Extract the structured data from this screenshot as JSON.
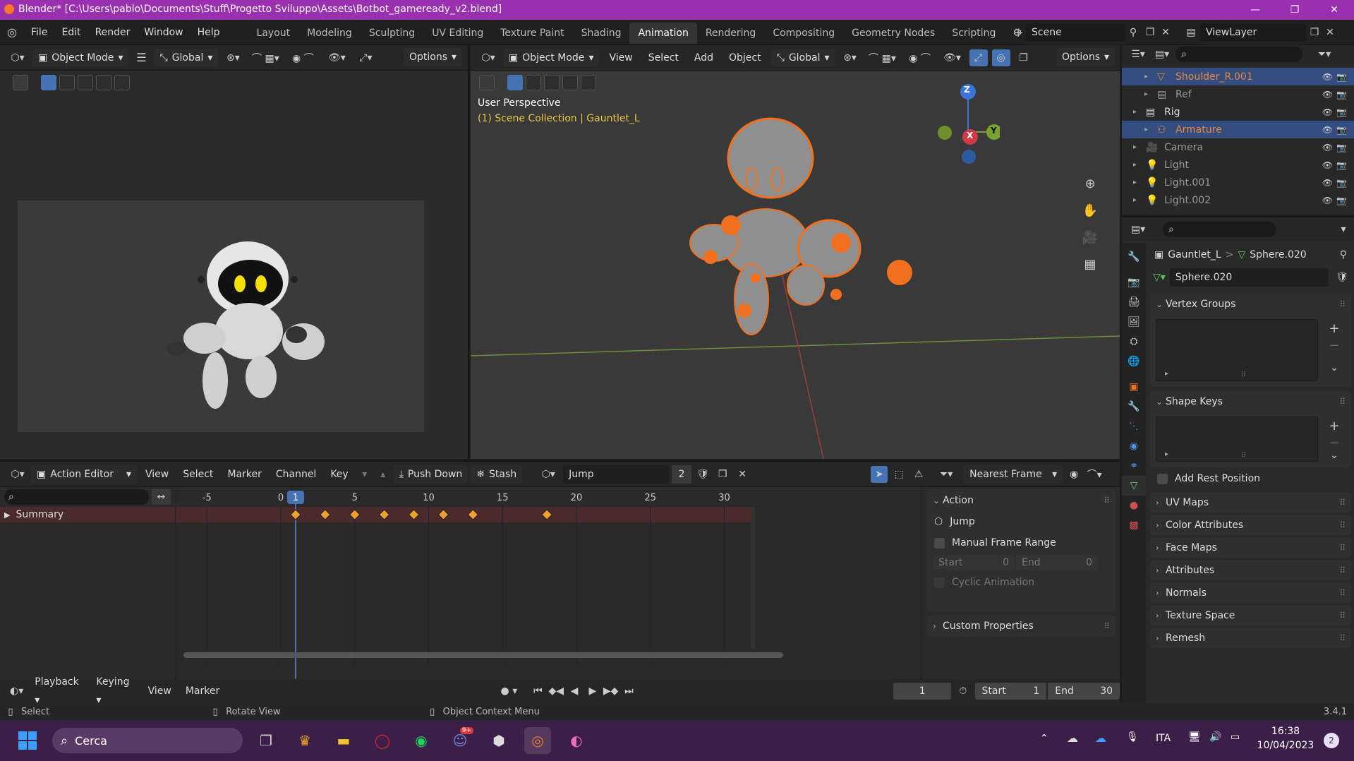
{
  "titlebar": {
    "title": "Blender* [C:\\Users\\pablo\\Documents\\Stuff\\Progetto Sviluppo\\Assets\\Botbot_gameready_v2.blend]",
    "minimize": "—",
    "maximize": "❐",
    "close": "✕"
  },
  "menu": {
    "items": [
      "File",
      "Edit",
      "Render",
      "Window",
      "Help"
    ]
  },
  "workspaces": {
    "tabs": [
      "Layout",
      "Modeling",
      "Sculpting",
      "UV Editing",
      "Texture Paint",
      "Shading",
      "Animation",
      "Rendering",
      "Compositing",
      "Geometry Nodes",
      "Scripting"
    ],
    "active": "Animation",
    "add": "+"
  },
  "scene": {
    "label": "Scene",
    "view_layer": "ViewLayer"
  },
  "left_view": {
    "mode": "Object Mode",
    "orientation": "Global",
    "options": "Options"
  },
  "viewport": {
    "mode": "Object Mode",
    "menus": [
      "View",
      "Select",
      "Add",
      "Object"
    ],
    "orientation": "Global",
    "options": "Options",
    "perspective": "User Perspective",
    "collection": "(1) Scene Collection | Gauntlet_L",
    "gizmo": {
      "z": "Z",
      "y": "Y",
      "x": "X"
    }
  },
  "outliner": {
    "rows": [
      {
        "name": "Shoulder_R.001",
        "selected": true,
        "color": "#e8873a"
      },
      {
        "name": "Ref",
        "selected": false,
        "color": "#999999"
      },
      {
        "name": "Rig",
        "selected": false,
        "color": "#dddddd"
      },
      {
        "name": "Armature",
        "selected": true,
        "color": "#e8873a"
      },
      {
        "name": "Camera",
        "selected": false,
        "color": "#999999"
      },
      {
        "name": "Light",
        "selected": false,
        "color": "#999999"
      },
      {
        "name": "Light.001",
        "selected": false,
        "color": "#999999"
      },
      {
        "name": "Light.002",
        "selected": false,
        "color": "#999999"
      }
    ]
  },
  "properties": {
    "breadcrumb_object": "Gauntlet_L",
    "breadcrumb_sep": ">",
    "breadcrumb_data": "Sphere.020",
    "data_name": "Sphere.020",
    "vertex_groups": "Vertex Groups",
    "shape_keys": "Shape Keys",
    "add_rest_position": "Add Rest Position",
    "collapsed": [
      "UV Maps",
      "Color Attributes",
      "Face Maps",
      "Attributes",
      "Normals",
      "Texture Space",
      "Remesh"
    ]
  },
  "action_editor": {
    "mode": "Action Editor",
    "menus": [
      "View",
      "Select",
      "Marker",
      "Channel",
      "Key"
    ],
    "push_down": "Push Down",
    "stash": "Stash",
    "action_name": "Jump",
    "users": "2",
    "snap": "Nearest Frame",
    "summary": "Summary",
    "ticks": [
      "-5",
      "0",
      "5",
      "10",
      "15",
      "20",
      "25",
      "30"
    ],
    "current_frame": "1",
    "keyframes": [
      1,
      3,
      5,
      7,
      9,
      11,
      13,
      18
    ]
  },
  "action_panel": {
    "title": "Action",
    "action_name": "Jump",
    "manual_range": "Manual Frame Range",
    "start_label": "Start",
    "start_value": "0",
    "end_label": "End",
    "end_value": "0",
    "cyclic": "Cyclic Animation",
    "custom_props": "Custom Properties"
  },
  "timeline": {
    "menus": [
      "Playback",
      "Keying",
      "View",
      "Marker"
    ],
    "current": "1",
    "start_label": "Start",
    "start": "1",
    "end_label": "End",
    "end": "30"
  },
  "statusbar": {
    "select": "Select",
    "rotate": "Rotate View",
    "context": "Object Context Menu",
    "version": "3.4.1"
  },
  "taskbar": {
    "search": "Cerca",
    "lang": "ITA",
    "time": "16:38",
    "date": "10/04/2023",
    "notif": "2",
    "discord_badge": "9+"
  },
  "colors": {
    "accent": "#4772b3",
    "selected_obj": "#e8873a",
    "keyframe": "#f0a030",
    "title": "#9a2fb0"
  }
}
